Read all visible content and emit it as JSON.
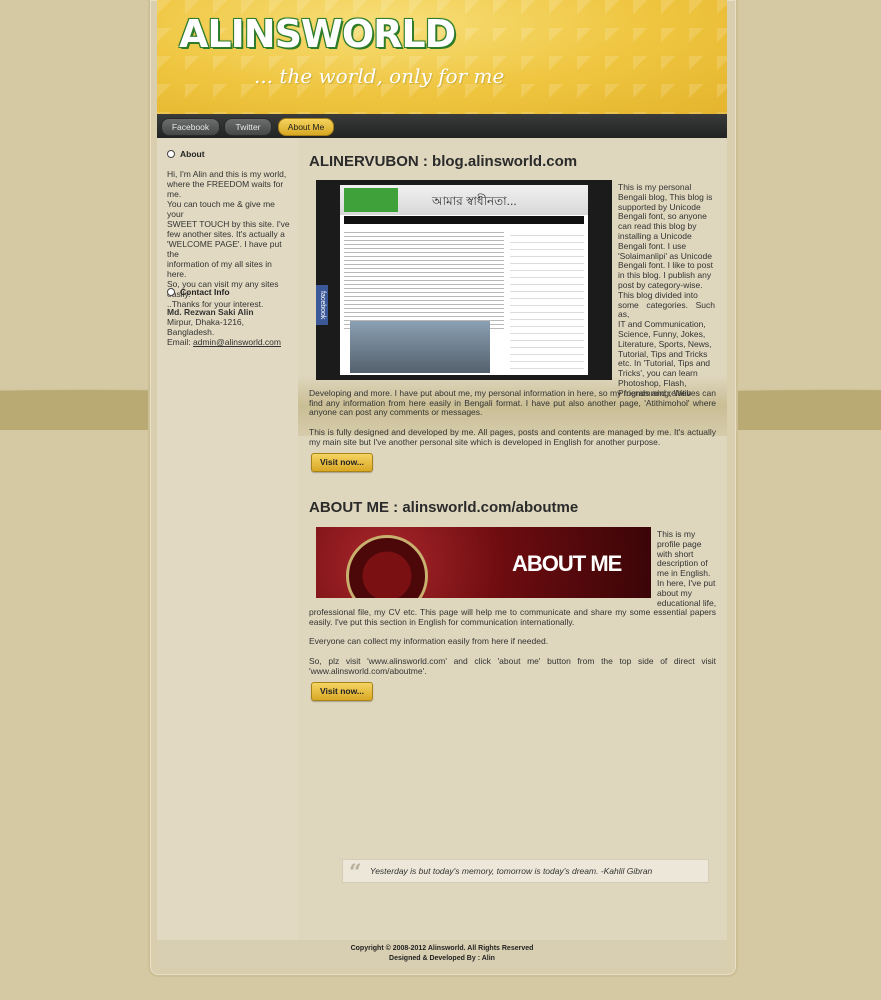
{
  "header": {
    "logo": "ALINSWORLD",
    "tagline": "... the world, only for me"
  },
  "nav": {
    "items": [
      {
        "label": "Facebook"
      },
      {
        "label": "Twitter"
      },
      {
        "label": "About Me",
        "active": true
      }
    ]
  },
  "sidebar": {
    "about": {
      "heading": "About",
      "lines": [
        "Hi, I'm Alin and this is my world,",
        "where the FREEDOM waits for me.",
        "You can touch me & give me your",
        "SWEET TOUCH by this site. I've",
        "few another sites. It's actually a",
        "'WELCOME PAGE'. I have put the",
        "information of my all sites in here.",
        "So, you can visit my any sites",
        "easily.",
        "..Thanks for your interest."
      ]
    },
    "contact": {
      "heading": "Contact Info",
      "name": "Md. Rezwan Saki Alin",
      "address": "Mirpur, Dhaka-1216, Bangladesh.",
      "email_label": "Email:",
      "email": "admin@alinsworld.com"
    }
  },
  "section1": {
    "title": "ALINERVUBON : blog.alinsworld.com",
    "float_lines": [
      "This is my personal",
      "Bengali blog, This blog is",
      "supported by Unicode",
      "Bengali font, so anyone",
      "can read this blog by",
      "installing a Unicode",
      "Bengali font. I use",
      "'Solaimanlipi' as Unicode",
      "Bengali font. I like to post",
      "in this blog. I publish any",
      "post by category-wise.",
      "This blog divided into",
      "some categories. Such as,",
      "IT and Communication,",
      "Science, Funny, Jokes,",
      "Literature, Sports, News,",
      "Tutorial, Tips and Tricks",
      "etc. In 'Tutorial, Tips and",
      "Tricks', you can learn",
      "Photoshop, Flash,",
      "Programming, Web"
    ],
    "para_rest": "Developing and more. I have put about me, my personal information in here, so my friends and relatives can find any information from here easily in Bengali format. I have put also another page, 'Atithimohol' where anyone can post any comments or messages.",
    "para2": "This is fully designed and developed by me. All pages, posts and contents are managed by me. It's actually my main site but I've another personal site which is developed in English for another purpose.",
    "button": "Visit now...",
    "screenshot_header": "আমার স্বাধীনতা...",
    "screenshot_badge": "facebook"
  },
  "section2": {
    "title": "ABOUT ME : alinsworld.com/aboutme",
    "banner_text": "ABOUT ME",
    "float_lines": [
      "This is my",
      "profile page",
      "with short",
      "description of",
      "me in English.",
      "In here, I've put",
      "about my",
      "educational life,"
    ],
    "para_rest": "professional file, my CV etc. This page will help me to communicate and share my some essential papers easily. I've put this section in English for communication internationally.",
    "para2": "Everyone can collect my information easily from here if needed.",
    "para3": "So, plz visit 'www.alinsworld.com' and click 'about me' button from the top side of direct visit 'www.alinsworld.com/aboutme'.",
    "button": "Visit now..."
  },
  "quote": {
    "mark": "“",
    "text": "Yesterday is but today's memory, tomorrow is today's dream. -Kahlil Gibran"
  },
  "footer": {
    "copyright": "Copyright © 2008-2012 Alinsworld. All Rights Reserved",
    "designed_prefix": "Designed & Developed By :",
    "designed_by": "Alin"
  }
}
